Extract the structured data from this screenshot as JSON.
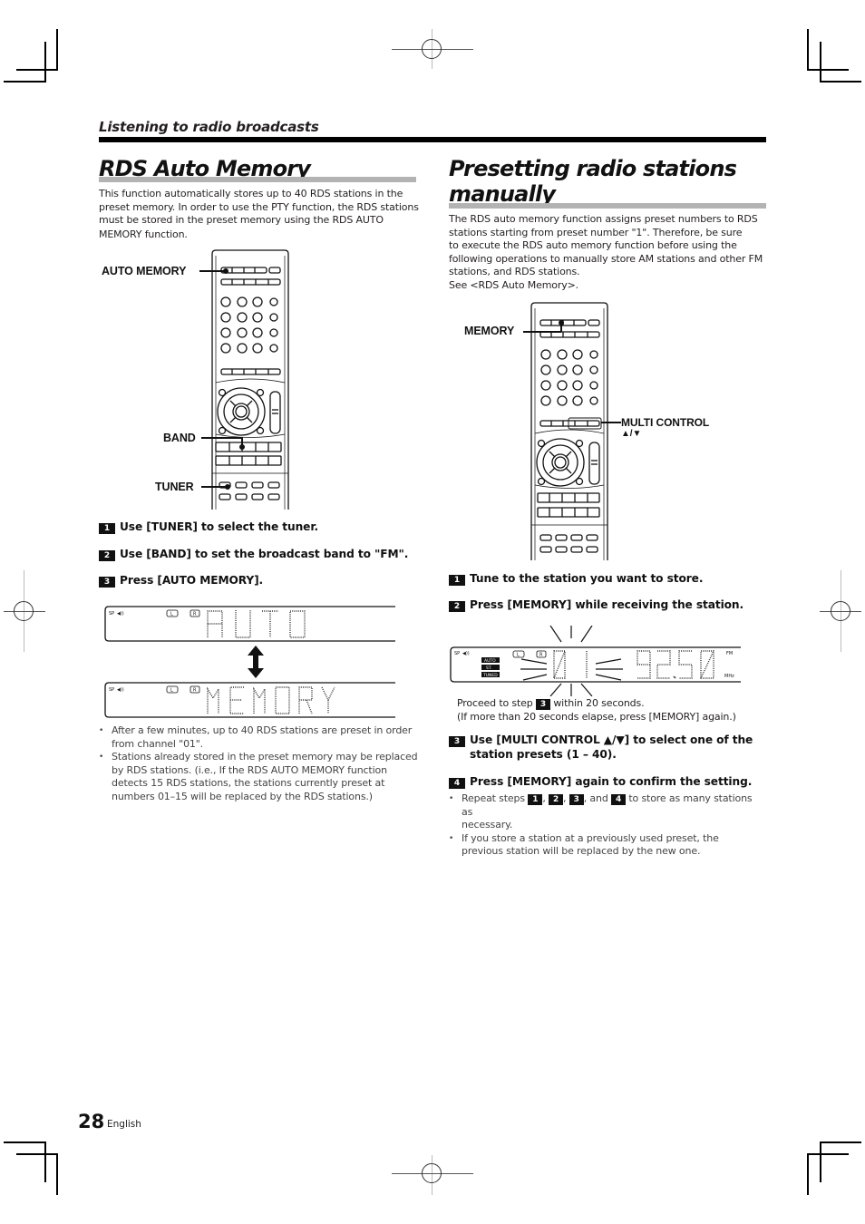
{
  "section_header": "Listening to radio broadcasts",
  "left": {
    "title": "RDS Auto Memory",
    "intro_lines": [
      "This function automatically stores up to 40 RDS stations in the",
      "preset memory. In order to use the PTY function, the RDS stations",
      "must be stored in the preset memory using the RDS AUTO",
      "MEMORY function."
    ],
    "remote_callouts": {
      "auto_memory": "AUTO MEMORY",
      "band": "BAND",
      "tuner": "TUNER"
    },
    "steps": [
      {
        "num": "1",
        "text": "Use [TUNER] to select the tuner."
      },
      {
        "num": "2",
        "text": "Use [BAND] to set the broadcast band to \"FM\"."
      },
      {
        "num": "3",
        "text": "Press [AUTO MEMORY]."
      }
    ],
    "display_1": {
      "indicator": "SP",
      "channel_left": "L",
      "channel_right": "R",
      "text": "AUTO"
    },
    "display_2": {
      "indicator": "SP",
      "channel_left": "L",
      "channel_right": "R",
      "text": "MEMORY"
    },
    "notes": [
      "After a few minutes, up to 40 RDS stations are preset in order from channel \"01\".",
      "Stations already stored in the preset memory may be replaced by RDS stations. (i.e., If the RDS AUTO MEMORY function detects 15 RDS stations, the stations currently preset at numbers 01–15 will be replaced by the RDS stations.)"
    ]
  },
  "right": {
    "title_line1": "Presetting radio stations",
    "title_line2": "manually",
    "intro_lines": [
      "The RDS auto memory function assigns preset numbers to RDS",
      "stations starting from preset number \"1\". Therefore, be sure",
      "to execute the RDS auto memory function before using the",
      "following operations to manually store AM stations and other FM",
      "stations, and RDS stations.",
      "See <RDS Auto Memory>."
    ],
    "remote_callouts": {
      "memory": "MEMORY",
      "multi_control": "MULTI CONTROL",
      "multi_control_arrows": "▲/▼"
    },
    "steps": [
      {
        "num": "1",
        "text": "Tune to the station you want to store."
      },
      {
        "num": "2",
        "text": "Press [MEMORY] while receiving the station."
      }
    ],
    "display": {
      "indicator": "SP",
      "badges": [
        "AUTO",
        "ST.",
        "TUNED"
      ],
      "channel_left": "L",
      "channel_right": "R",
      "preset": "01",
      "frequency": "92.50",
      "band": "FM",
      "unit": "MHz"
    },
    "proceed_prefix": "Proceed to step",
    "proceed_step": "3",
    "proceed_suffix": "within 20 seconds.",
    "proceed_note": "(If more than 20 seconds elapse, press [MEMORY] again.)",
    "steps_after": [
      {
        "num": "3",
        "text_line1": "Use [MULTI CONTROL ▲/▼] to select one of the",
        "text_line2": "station presets (1 – 40)."
      },
      {
        "num": "4",
        "text_line1": "Press [MEMORY] again to confirm the setting.",
        "text_line2": ""
      }
    ],
    "note1_prefix": "Repeat steps",
    "note1_steps": [
      "1",
      "2",
      "3",
      "4"
    ],
    "note1_and": ", and",
    "note1_suffix": "to store as many stations as",
    "note1_line2": "necessary.",
    "note2": "If you store a station at a previously used preset, the previous station will be replaced by the new one."
  },
  "footer": {
    "page_number": "28",
    "language": "English"
  }
}
